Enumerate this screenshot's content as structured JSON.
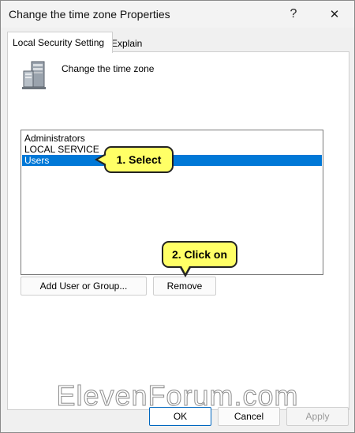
{
  "window": {
    "title": "Change the time zone Properties",
    "help_glyph": "?",
    "close_glyph": "✕"
  },
  "tabs": [
    {
      "label": "Local Security Setting",
      "active": true
    },
    {
      "label": "Explain",
      "active": false
    }
  ],
  "policy": {
    "icon": "server-icon",
    "name": "Change the time zone"
  },
  "list": {
    "items": [
      "Administrators",
      "LOCAL SERVICE",
      "Users"
    ],
    "selected": "Users"
  },
  "buttons": {
    "add": "Add User or Group...",
    "remove": "Remove",
    "ok": "OK",
    "cancel": "Cancel",
    "apply": "Apply"
  },
  "callouts": {
    "select": "1. Select",
    "click": "2. Click on"
  },
  "watermark": "ElevenForum.com",
  "colors": {
    "selection": "#0078d7",
    "callout_fill": "#ffff66",
    "ok_border": "#0067c0"
  }
}
